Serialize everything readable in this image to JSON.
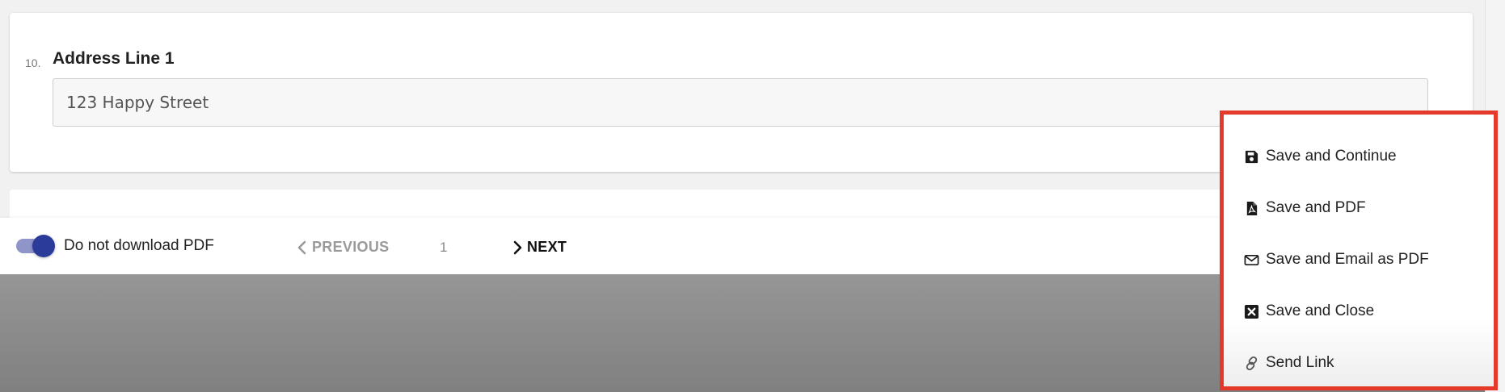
{
  "question": {
    "number": "10.",
    "label": "Address Line 1",
    "value": "123 Happy Street"
  },
  "bottom_bar": {
    "toggle_label": "Do not download PDF",
    "toggle_on": true,
    "prev_label": "PREVIOUS",
    "page_number": "1",
    "next_label": "NEXT"
  },
  "save_menu": {
    "items": [
      {
        "label": "Save and Continue",
        "icon": "floppy-disk-icon"
      },
      {
        "label": "Save and PDF",
        "icon": "pdf-file-icon"
      },
      {
        "label": "Save and Email as PDF",
        "icon": "envelope-icon"
      },
      {
        "label": "Save and Close",
        "icon": "close-square-icon"
      },
      {
        "label": "Send Link",
        "icon": "link-icon"
      }
    ]
  },
  "colors": {
    "accent": "#2b3b9a",
    "toggle_track": "#8f94c9",
    "highlight_border": "#e5392b"
  }
}
